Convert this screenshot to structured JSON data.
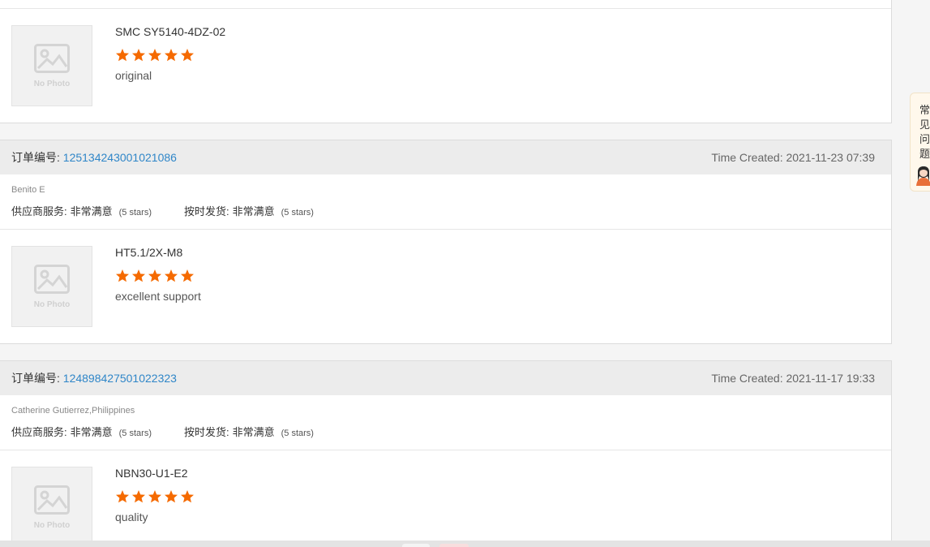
{
  "reviews": [
    {
      "product": {
        "image_placeholder": "No Photo",
        "name": "SMC SY5140-4DZ-02",
        "rating": 5,
        "comment": "original"
      }
    },
    {
      "order_label": "订单编号:",
      "order_id": "125134243001021086",
      "time_created": "Time Created: 2021-11-23 07:39",
      "buyer": "Benito E",
      "supplier_service": {
        "label": "供应商服务:",
        "value": "非常满意",
        "stars": "(5 stars)"
      },
      "on_time_delivery": {
        "label": "按时发货:",
        "value": "非常满意",
        "stars": "(5 stars)"
      },
      "product": {
        "image_placeholder": "No Photo",
        "name": "HT5.1/2X-M8",
        "rating": 5,
        "comment": "excellent support"
      }
    },
    {
      "order_label": "订单编号:",
      "order_id": "124898427501022323",
      "time_created": "Time Created: 2021-11-17 19:33",
      "buyer": "Catherine Gutierrez,Philippines",
      "supplier_service": {
        "label": "供应商服务:",
        "value": "非常满意",
        "stars": "(5 stars)"
      },
      "on_time_delivery": {
        "label": "按时发货:",
        "value": "非常满意",
        "stars": "(5 stars)"
      },
      "product": {
        "image_placeholder": "No Photo",
        "name": "NBN30-U1-E2",
        "rating": 5,
        "comment": "quality"
      }
    }
  ],
  "side_help": {
    "label": "常见问题",
    "icon": "customer-service-avatar-icon"
  },
  "colors": {
    "star": "#f56a00",
    "link": "#2f86c8",
    "header_bg": "#ececec"
  }
}
